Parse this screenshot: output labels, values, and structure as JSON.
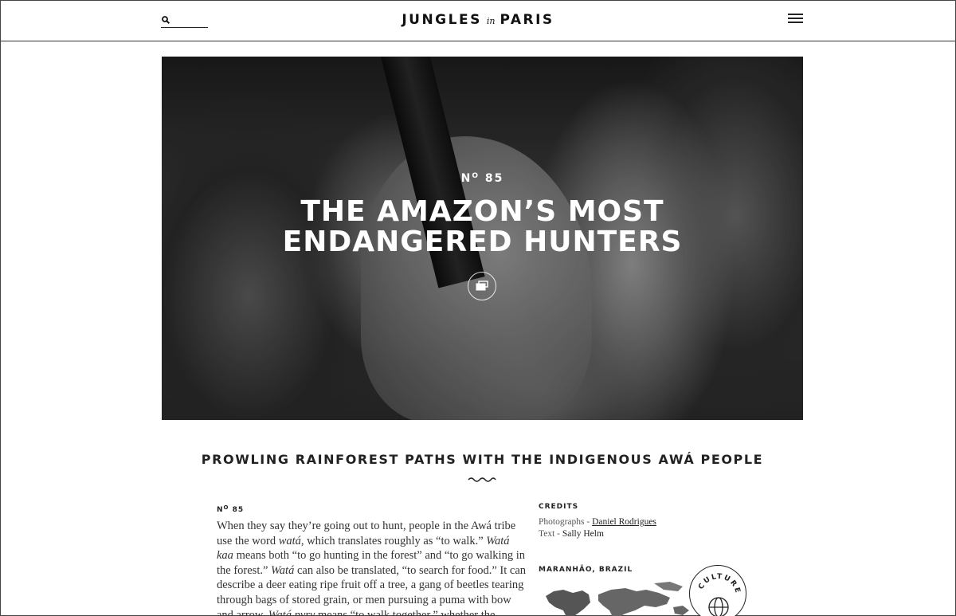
{
  "header": {
    "search_placeholder": "",
    "logo_left": "JUNGLES",
    "logo_in": "in",
    "logo_right": "PARIS",
    "icons": {
      "search": "search-icon",
      "menu": "hamburger-menu-icon"
    }
  },
  "hero": {
    "issue_prefix": "N",
    "issue_sup": "O",
    "issue_number": "85",
    "title": "THE AMAZON’S MOST ENDANGERED HUNTERS",
    "gallery_icon": "gallery-icon"
  },
  "article": {
    "subtitle": "PROWLING RAINFOREST PATHS WITH THE INDIGENOUS AWÁ PEOPLE",
    "issue_prefix": "N",
    "issue_sup": "O",
    "issue_number": "85",
    "body": {
      "t1": "When they say they’re going out to hunt, people in the Awá tribe use the word ",
      "e1": "watá",
      "t2": ", which translates roughly as “to walk.” ",
      "e2": "Watá kaa",
      "t3": " means both “to go hunting in the forest” and “to go walking in the forest.” ",
      "e3": "Watá",
      "t4": " can also be translated, “to search for food.” It can describe a deer eating ripe fruit off a tree, a gang of beetles tearing through bags of stored grain, or men pursuing a puma with bow and arrow. ",
      "e4": "Watá pyry",
      "t5": " means “to walk together,” whether the walkers are a team of hunters or"
    }
  },
  "sidebar": {
    "credits_heading": "CREDITS",
    "photographs_label": "Photographs - ",
    "photographs_name": "Daniel Rodrigues",
    "text_label": "Text - ",
    "text_name": "Sally Helm",
    "location_heading": "MARANHÃO, BRAZIL",
    "badge_text": "CULTURE",
    "map_icon": "world-map-icon"
  }
}
